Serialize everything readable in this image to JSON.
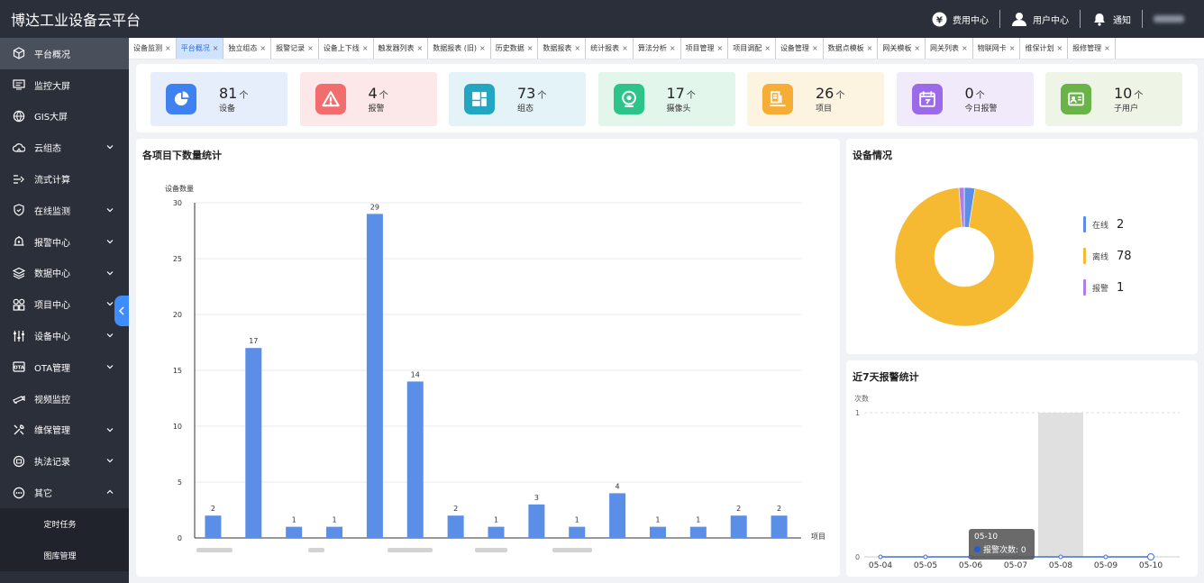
{
  "app": {
    "title": "博达工业设备云平台"
  },
  "top_actions": [
    {
      "label": "费用中心",
      "icon": "yen-icon"
    },
    {
      "label": "用户中心",
      "icon": "user-icon"
    },
    {
      "label": "通知",
      "icon": "bell-icon"
    }
  ],
  "sidebar": {
    "items": [
      {
        "label": "平台概况",
        "icon": "cube-icon",
        "active": true,
        "chevron": ""
      },
      {
        "label": "监控大屏",
        "icon": "monitor-icon",
        "active": false,
        "chevron": ""
      },
      {
        "label": "GIS大屏",
        "icon": "globe-icon",
        "active": false,
        "chevron": ""
      },
      {
        "label": "云组态",
        "icon": "cloud-icon",
        "active": false,
        "chevron": "down"
      },
      {
        "label": "流式计算",
        "icon": "flow-icon",
        "active": false,
        "chevron": ""
      },
      {
        "label": "在线监测",
        "icon": "shield-icon",
        "active": false,
        "chevron": "down"
      },
      {
        "label": "报警中心",
        "icon": "alarm-icon",
        "active": false,
        "chevron": "down"
      },
      {
        "label": "数据中心",
        "icon": "layers-icon",
        "active": false,
        "chevron": "down"
      },
      {
        "label": "项目中心",
        "icon": "grid-icon",
        "active": false,
        "chevron": "down"
      },
      {
        "label": "设备中心",
        "icon": "sliders-icon",
        "active": false,
        "chevron": "down"
      },
      {
        "label": "OTA管理",
        "icon": "ota-icon",
        "active": false,
        "chevron": "down"
      },
      {
        "label": "视频监控",
        "icon": "camera-icon",
        "active": false,
        "chevron": ""
      },
      {
        "label": "维保管理",
        "icon": "tools-icon",
        "active": false,
        "chevron": "down"
      },
      {
        "label": "执法记录",
        "icon": "record-icon",
        "active": false,
        "chevron": "down"
      },
      {
        "label": "其它",
        "icon": "more-icon",
        "active": false,
        "chevron": "up"
      }
    ],
    "subitems": [
      "定时任务",
      "图库管理"
    ]
  },
  "tabs": [
    {
      "label": "设备监测",
      "active": false
    },
    {
      "label": "平台概况",
      "active": true
    },
    {
      "label": "独立组态",
      "active": false
    },
    {
      "label": "报警记录",
      "active": false
    },
    {
      "label": "设备上下线",
      "active": false
    },
    {
      "label": "触发器列表",
      "active": false
    },
    {
      "label": "数据报表 (旧)",
      "active": false
    },
    {
      "label": "历史数据",
      "active": false
    },
    {
      "label": "数据报表",
      "active": false
    },
    {
      "label": "统计报表",
      "active": false
    },
    {
      "label": "算法分析",
      "active": false
    },
    {
      "label": "项目管理",
      "active": false
    },
    {
      "label": "项目调配",
      "active": false
    },
    {
      "label": "设备管理",
      "active": false
    },
    {
      "label": "数据点模板",
      "active": false
    },
    {
      "label": "网关模板",
      "active": false
    },
    {
      "label": "网关列表",
      "active": false
    },
    {
      "label": "物联网卡",
      "active": false
    },
    {
      "label": "维保计划",
      "active": false
    },
    {
      "label": "报修管理",
      "active": false
    }
  ],
  "stats": [
    {
      "value": "81",
      "unit": "个",
      "label": "设备",
      "bg": "#e6eefc",
      "icon_bg": "#3d82f0",
      "icon": "pie-icon"
    },
    {
      "value": "4",
      "unit": "个",
      "label": "报警",
      "bg": "#fce8e8",
      "icon_bg": "#f26d6d",
      "icon": "warning-icon"
    },
    {
      "value": "73",
      "unit": "个",
      "label": "组态",
      "bg": "#e3f3f7",
      "icon_bg": "#22a6c2",
      "icon": "dashboard-icon"
    },
    {
      "value": "17",
      "unit": "个",
      "label": "摄像头",
      "bg": "#e3f6ec",
      "icon_bg": "#2cc489",
      "icon": "webcam-icon"
    },
    {
      "value": "26",
      "unit": "个",
      "label": "项目",
      "bg": "#fcf3e1",
      "icon_bg": "#f6ad35",
      "icon": "project-icon"
    },
    {
      "value": "0",
      "unit": "个",
      "label": "今日报警",
      "bg": "#f0eafb",
      "icon_bg": "#9b6ae8",
      "icon": "calendar-icon"
    },
    {
      "value": "10",
      "unit": "个",
      "label": "子用户",
      "bg": "#eef5e6",
      "icon_bg": "#6ab34a",
      "icon": "subuser-icon"
    }
  ],
  "bar_panel": {
    "title": "各项目下数量统计"
  },
  "device_panel": {
    "title": "设备情况"
  },
  "alarm_panel": {
    "title": "近7天报警统计"
  },
  "chart_data": [
    {
      "type": "bar",
      "title": "各项目下数量统计",
      "ylabel": "设备数量",
      "xlabel": "项目",
      "ylim": [
        0,
        30
      ],
      "yticks": [
        0,
        5,
        10,
        15,
        20,
        25,
        30
      ],
      "values": [
        2,
        17,
        1,
        1,
        29,
        14,
        2,
        1,
        3,
        1,
        4,
        1,
        1,
        2,
        2
      ],
      "color": "#5b8ee6",
      "grid": true
    },
    {
      "type": "pie",
      "title": "设备情况",
      "donut": true,
      "slices": [
        {
          "name": "在线",
          "value": 2,
          "color": "#5b8ee6"
        },
        {
          "name": "离线",
          "value": 78,
          "color": "#f6b932"
        },
        {
          "name": "报警",
          "value": 1,
          "color": "#b07ee6"
        }
      ],
      "legend": "right"
    },
    {
      "type": "line",
      "title": "近7天报警统计",
      "ylabel": "次数",
      "x": [
        "05-04",
        "05-05",
        "05-06",
        "05-07",
        "05-08",
        "05-09",
        "05-10"
      ],
      "ylim": [
        0,
        1
      ],
      "yticks": [
        0,
        1
      ],
      "series": [
        {
          "name": "报警次数",
          "values": [
            0,
            0,
            0,
            0,
            0,
            0,
            0
          ],
          "color": "#3d6fe0"
        }
      ],
      "highlight_band": "05-08",
      "tooltip": {
        "title": "05-10",
        "label": "报警次数",
        "value": "0"
      }
    }
  ]
}
